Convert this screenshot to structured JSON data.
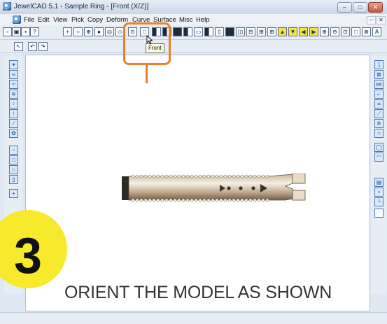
{
  "window": {
    "title": "JewelCAD 5.1 - Sample Ring - [Front (X/Z)]",
    "controls": [
      "–",
      "□",
      "✕"
    ]
  },
  "menubar": {
    "items": [
      "File",
      "Edit",
      "View",
      "Pick",
      "Copy",
      "Deform",
      "Curve",
      "Surface",
      "Misc",
      "Help"
    ],
    "mdi_controls": [
      "–",
      "✕"
    ]
  },
  "toolbar": {
    "tooltip": "Front",
    "highlighted_button": "front-view-button"
  },
  "overlay": {
    "step_number": "3",
    "caption": "ORIENT THE MODEL AS SHOWN",
    "accent_color": "#e8822a",
    "badge_color": "#f7e92b"
  }
}
